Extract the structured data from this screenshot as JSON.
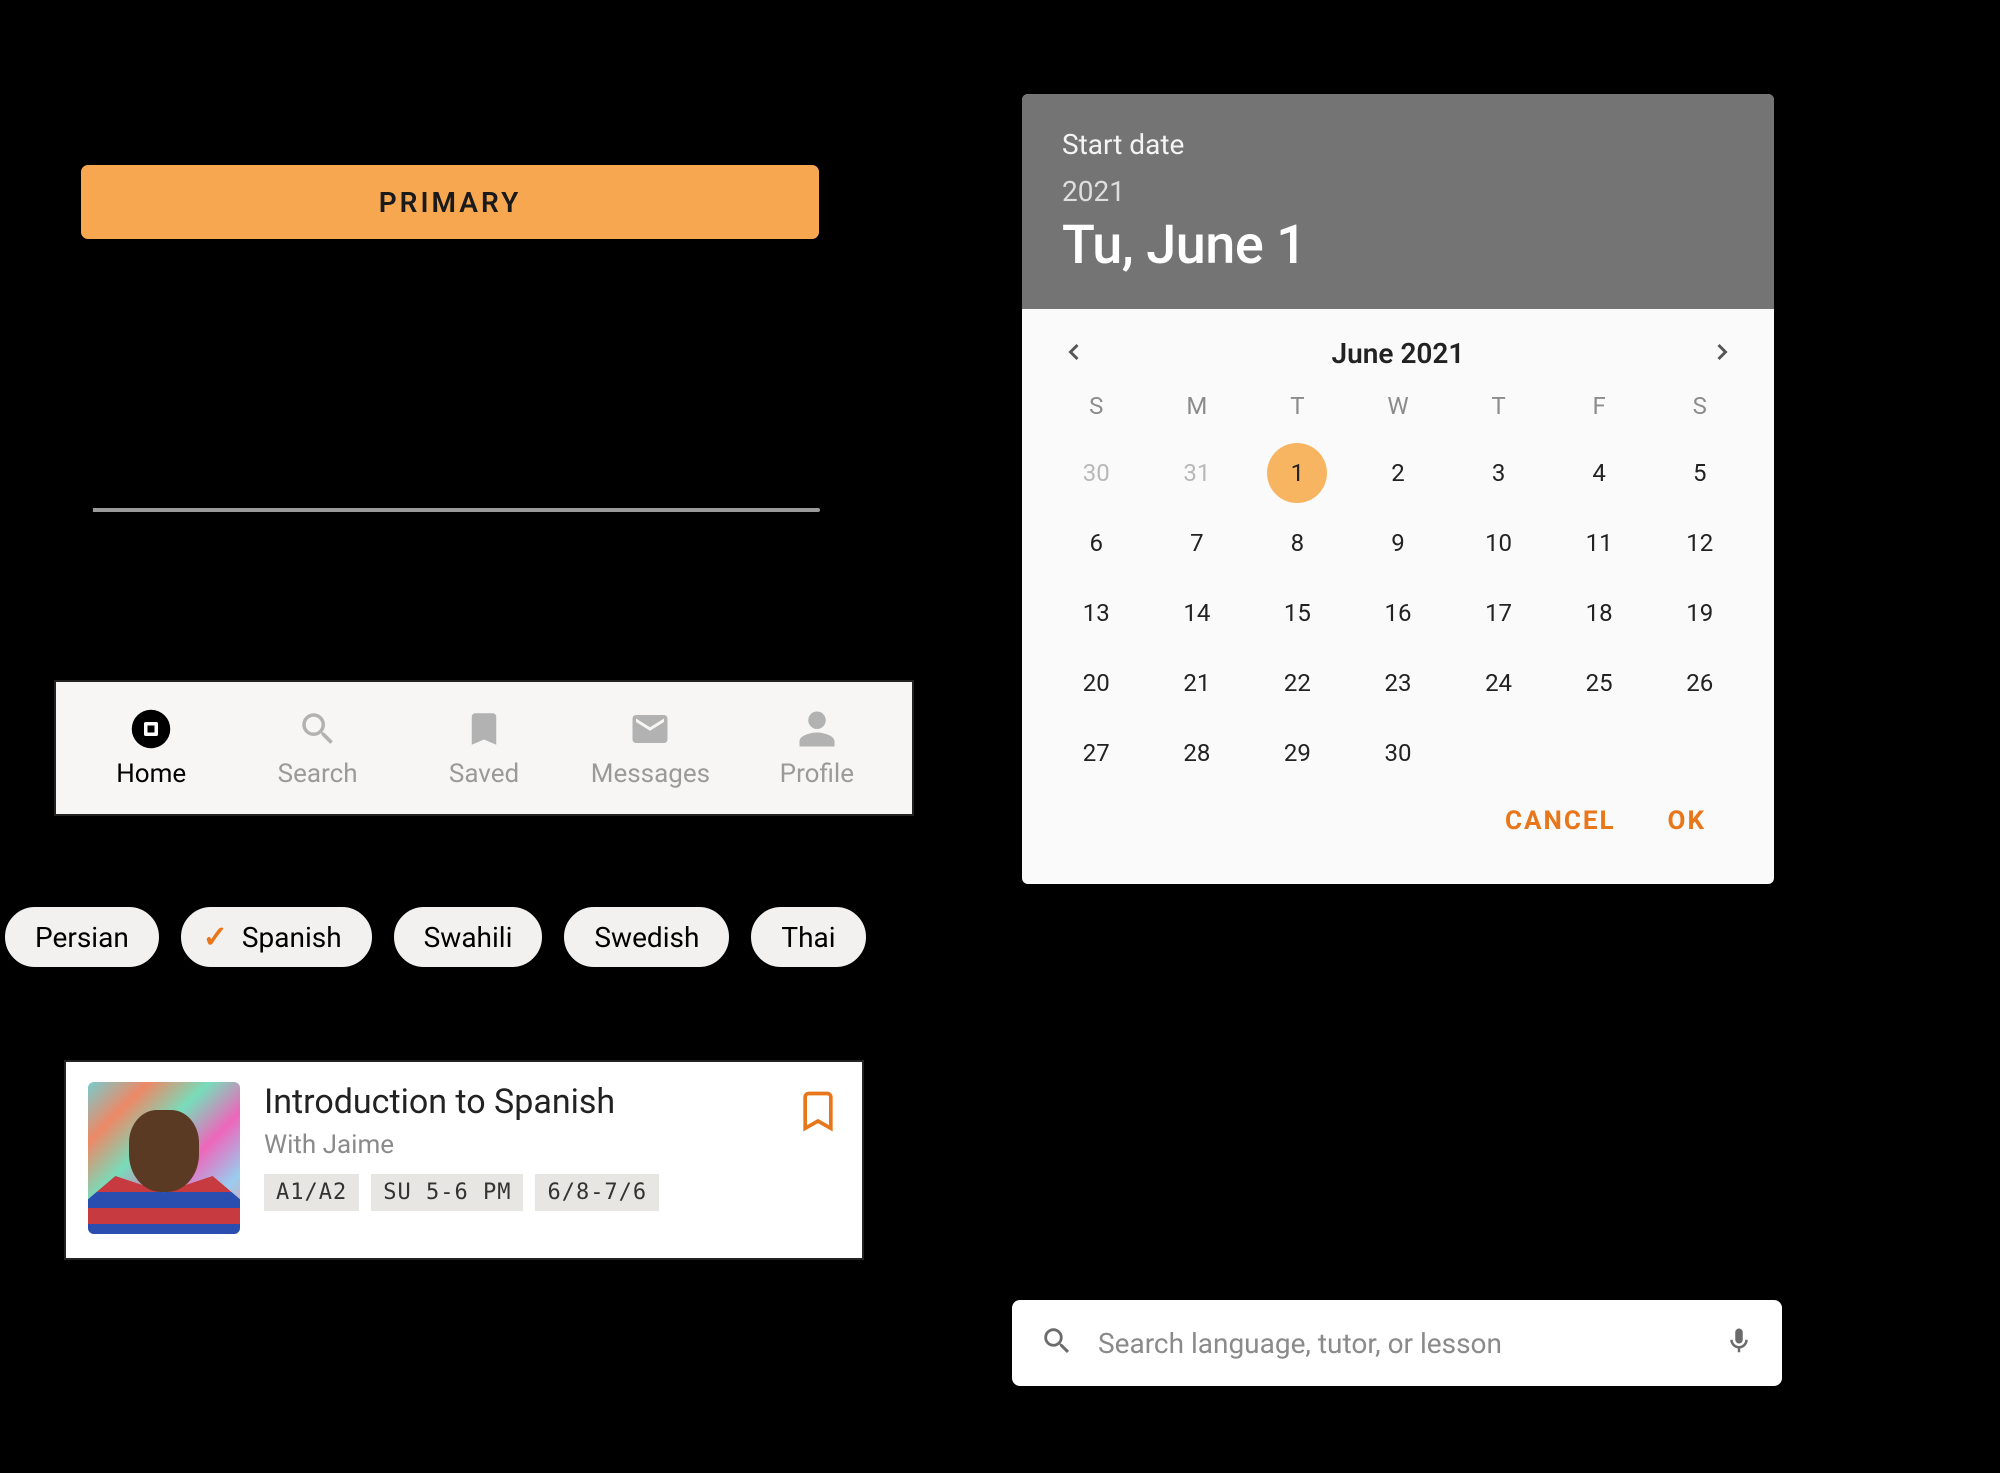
{
  "primary_button": {
    "label": "PRIMARY"
  },
  "slider": {
    "value": 0,
    "min": 0,
    "max": 100
  },
  "bottom_nav": {
    "items": [
      {
        "label": "Home",
        "active": true
      },
      {
        "label": "Search",
        "active": false
      },
      {
        "label": "Saved",
        "active": false
      },
      {
        "label": "Messages",
        "active": false
      },
      {
        "label": "Profile",
        "active": false
      }
    ]
  },
  "chips": [
    {
      "label": "Persian",
      "selected": false
    },
    {
      "label": "Spanish",
      "selected": true
    },
    {
      "label": "Swahili",
      "selected": false
    },
    {
      "label": "Swedish",
      "selected": false
    },
    {
      "label": "Thai",
      "selected": false
    }
  ],
  "lesson_card": {
    "title": "Introduction to Spanish",
    "subtitle": "With Jaime",
    "tags": [
      "A1/A2",
      "SU 5-6 PM",
      "6/8-7/6"
    ],
    "bookmarked": false
  },
  "datepicker": {
    "header_label": "Start date",
    "year": "2021",
    "selected_text": "Tu, June 1",
    "month_label": "June 2021",
    "weekdays": [
      "S",
      "M",
      "T",
      "W",
      "T",
      "F",
      "S"
    ],
    "leading_out": [
      30,
      31
    ],
    "selected_day": 1,
    "days_in_month": 30,
    "actions": {
      "cancel": "CANCEL",
      "ok": "OK"
    }
  },
  "searchbar": {
    "placeholder": "Search language, tutor, or lesson"
  },
  "colors": {
    "accent": "#f7a74f",
    "accent_text": "#e8761a"
  }
}
